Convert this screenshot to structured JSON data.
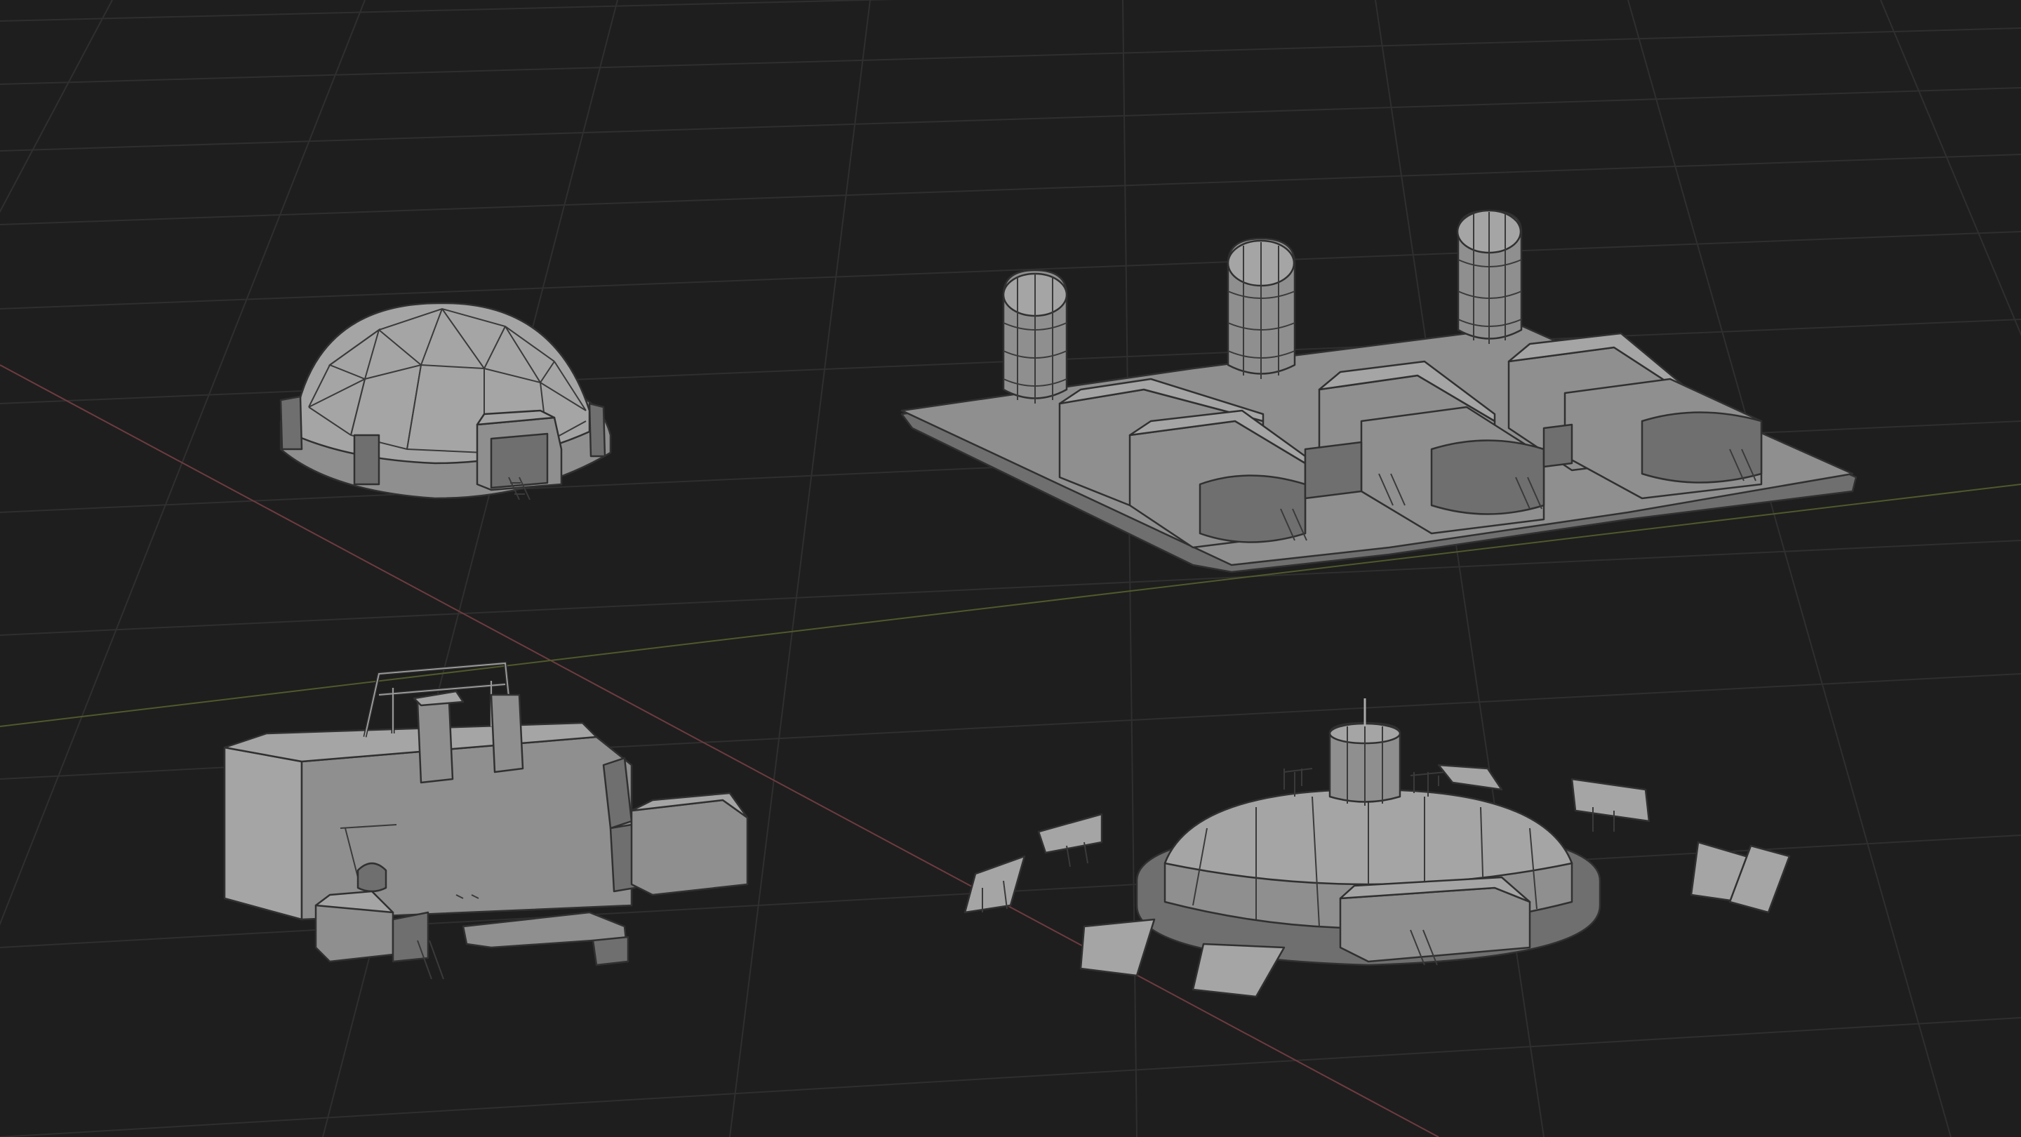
{
  "viewport": {
    "background_color": "#1e1e1e",
    "grid_color": "#2f2f2f",
    "x_axis_color": "#6e3b40",
    "y_axis_color": "#4f5a2b",
    "mesh_color": "#8f8f8f",
    "wire_color": "#303030"
  },
  "objects": [
    {
      "name": "geodesic-dome"
    },
    {
      "name": "silo-complex"
    },
    {
      "name": "industrial-block"
    },
    {
      "name": "round-base-with-solar-panels"
    }
  ]
}
